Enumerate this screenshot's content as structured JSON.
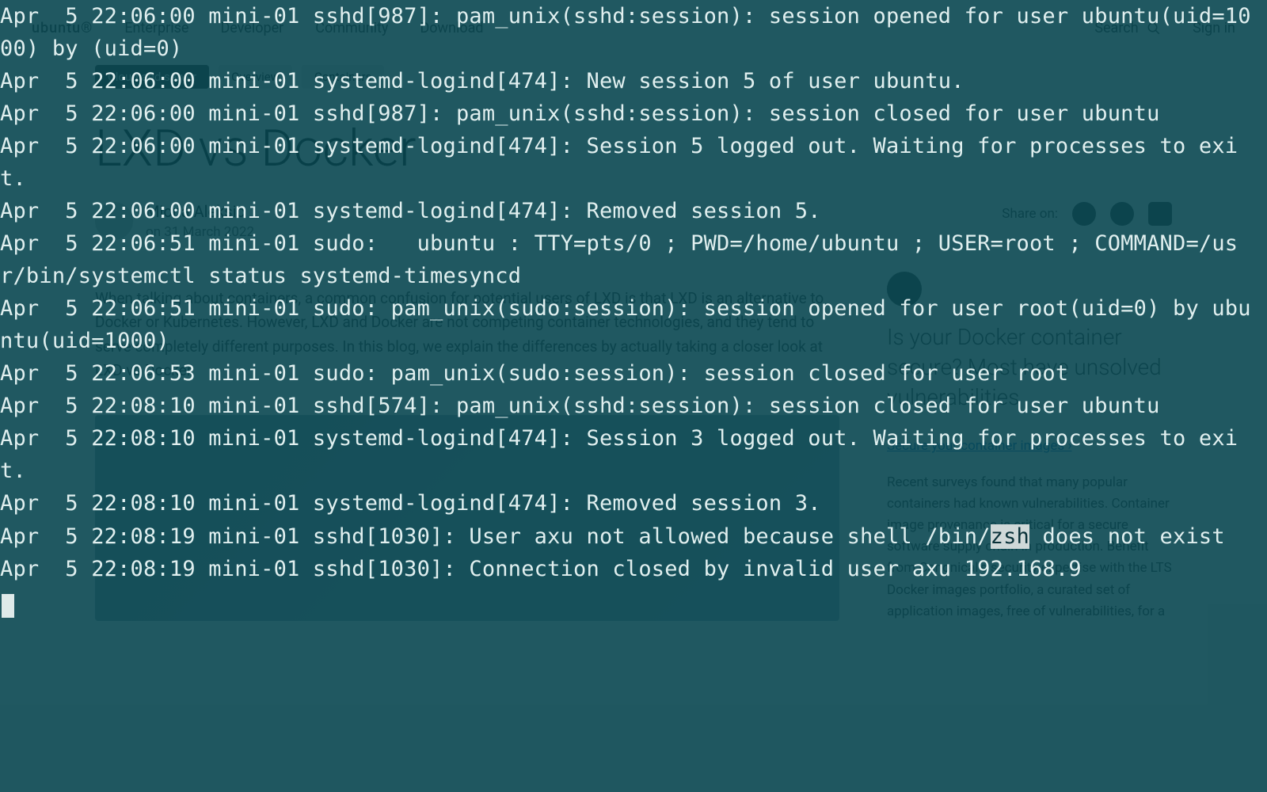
{
  "page": {
    "logo": "ubuntu®",
    "nav": [
      "Enterprise",
      "Developer",
      "Community",
      "Download"
    ],
    "search_label": "Search",
    "signin_label": "Sign in",
    "tags": [
      {
        "label": "Cloud and server",
        "primary": true
      },
      {
        "label": "Overview"
      },
      {
        "label": "Containers"
      }
    ],
    "title": "LXD vs Docker",
    "author": "Miona Aleksic",
    "date": "on 31 March 2022",
    "share_label": "Share on:",
    "body_p1": "When talking about containers, a common confusion for potential users of LXD is that LXD is an alternative to Docker or Kubernetes. However, LXD and Docker are not competing container technologies, and they tend to serve completely different purposes. In this blog, we explain the differences by actually taking a closer look at LXD vs Docker.",
    "side_title": "Is your Docker container secure? Most have unsolved vulnerabilities",
    "side_link": "Secure your container images ›",
    "side_body": "Recent surveys found that many popular containers had known vulnerabilities. Container image provenance is critical for a secure software supply chain in production. Benefit from Canonical's security expertise with the LTS Docker images portfolio, a curated set of application images, free of vulnerabilities, for a"
  },
  "terminal": {
    "log_lines": [
      "Apr  5 22:06:00 mini-01 sshd[987]: pam_unix(sshd:session): session opened for user ubuntu(uid=1000) by (uid=0)",
      "Apr  5 22:06:00 mini-01 systemd-logind[474]: New session 5 of user ubuntu.",
      "Apr  5 22:06:00 mini-01 sshd[987]: pam_unix(sshd:session): session closed for user ubuntu",
      "Apr  5 22:06:00 mini-01 systemd-logind[474]: Session 5 logged out. Waiting for processes to exit.",
      "Apr  5 22:06:00 mini-01 systemd-logind[474]: Removed session 5.",
      "Apr  5 22:06:51 mini-01 sudo:   ubuntu : TTY=pts/0 ; PWD=/home/ubuntu ; USER=root ; COMMAND=/usr/bin/systemctl status systemd-timesyncd",
      "Apr  5 22:06:51 mini-01 sudo: pam_unix(sudo:session): session opened for user root(uid=0) by ubuntu(uid=1000)",
      "Apr  5 22:06:53 mini-01 sudo: pam_unix(sudo:session): session closed for user root",
      "Apr  5 22:08:10 mini-01 sshd[574]: pam_unix(sshd:session): session closed for user ubuntu",
      "Apr  5 22:08:10 mini-01 systemd-logind[474]: Session 3 logged out. Waiting for processes to exit.",
      "Apr  5 22:08:10 mini-01 systemd-logind[474]: Removed session 3."
    ],
    "last1_pre": "Apr  5 22:08:19 mini-01 sshd[1030]: User axu not allowed because shell /bin/",
    "last1_hl": "zsh",
    "last1_post": " does not exist",
    "last2": "Apr  5 22:08:19 mini-01 sshd[1030]: Connection closed by invalid user axu 192.168.9"
  }
}
